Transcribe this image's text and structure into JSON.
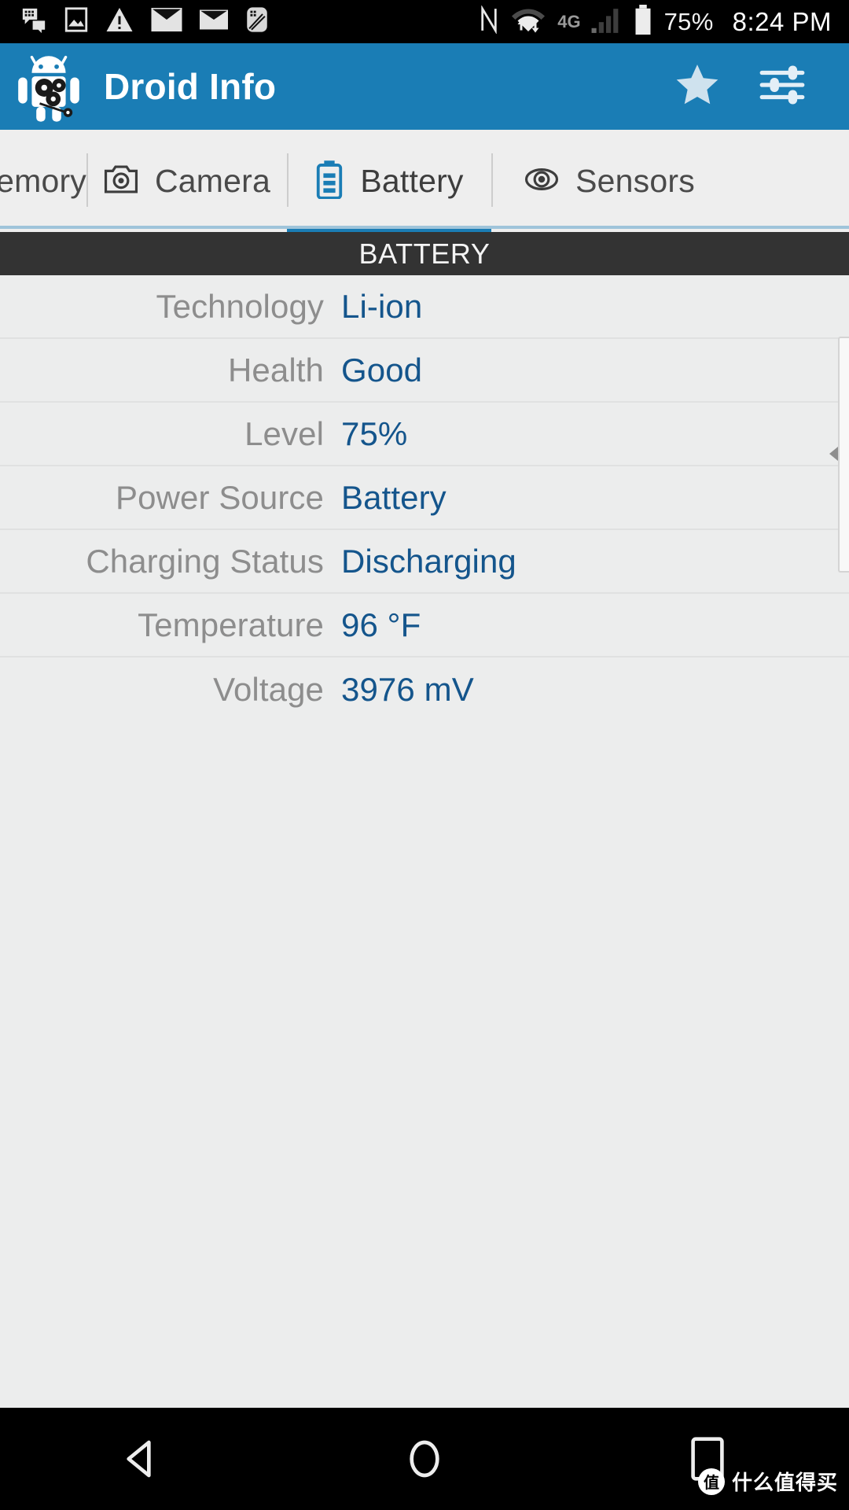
{
  "status_bar": {
    "battery_percent": "75%",
    "clock": "8:24 PM",
    "network_type": "4G",
    "left_icons": [
      {
        "name": "bbm-chat-icon"
      },
      {
        "name": "screenshot-image-icon"
      },
      {
        "name": "warning-triangle-icon"
      },
      {
        "name": "mail-envelope-icon"
      },
      {
        "name": "mail-envelope-open-icon"
      },
      {
        "name": "blackberry-hub-icon"
      }
    ],
    "right_icons": [
      {
        "name": "nfc-icon"
      },
      {
        "name": "wifi-icon"
      },
      {
        "name": "signal-bars-icon"
      },
      {
        "name": "battery-icon"
      }
    ]
  },
  "app_bar": {
    "title": "Droid Info",
    "logo_name": "droid-info-logo",
    "actions": [
      {
        "name": "favorite-star-button",
        "icon": "star-icon"
      },
      {
        "name": "settings-sliders-button",
        "icon": "sliders-icon"
      }
    ]
  },
  "tabs": [
    {
      "label": "Memory",
      "icon": "memory-icon",
      "active": false,
      "truncated": true
    },
    {
      "label": "Camera",
      "icon": "camera-icon",
      "active": false
    },
    {
      "label": "Battery",
      "icon": "battery-tab-icon",
      "active": true
    },
    {
      "label": "Sensors",
      "icon": "eye-sensor-icon",
      "active": false
    }
  ],
  "section": {
    "title": "BATTERY"
  },
  "rows": [
    {
      "label": "Technology",
      "value": "Li-ion"
    },
    {
      "label": "Health",
      "value": "Good"
    },
    {
      "label": "Level",
      "value": "75%"
    },
    {
      "label": "Power Source",
      "value": "Battery"
    },
    {
      "label": "Charging Status",
      "value": "Discharging"
    },
    {
      "label": "Temperature",
      "value": "96 °F"
    },
    {
      "label": "Voltage",
      "value": "3976 mV"
    }
  ],
  "nav_bar": {
    "buttons": [
      {
        "name": "back-button",
        "icon": "triangle-back-icon"
      },
      {
        "name": "home-button",
        "icon": "circle-home-icon"
      },
      {
        "name": "recents-button",
        "icon": "square-recents-icon"
      }
    ]
  },
  "watermark": {
    "badge": "值",
    "text": "什么值得买"
  },
  "colors": {
    "accent": "#1a7db5",
    "value_text": "#14558c",
    "label_text": "#8d8d8d",
    "section_bg": "#333333",
    "page_bg": "#eceded"
  }
}
